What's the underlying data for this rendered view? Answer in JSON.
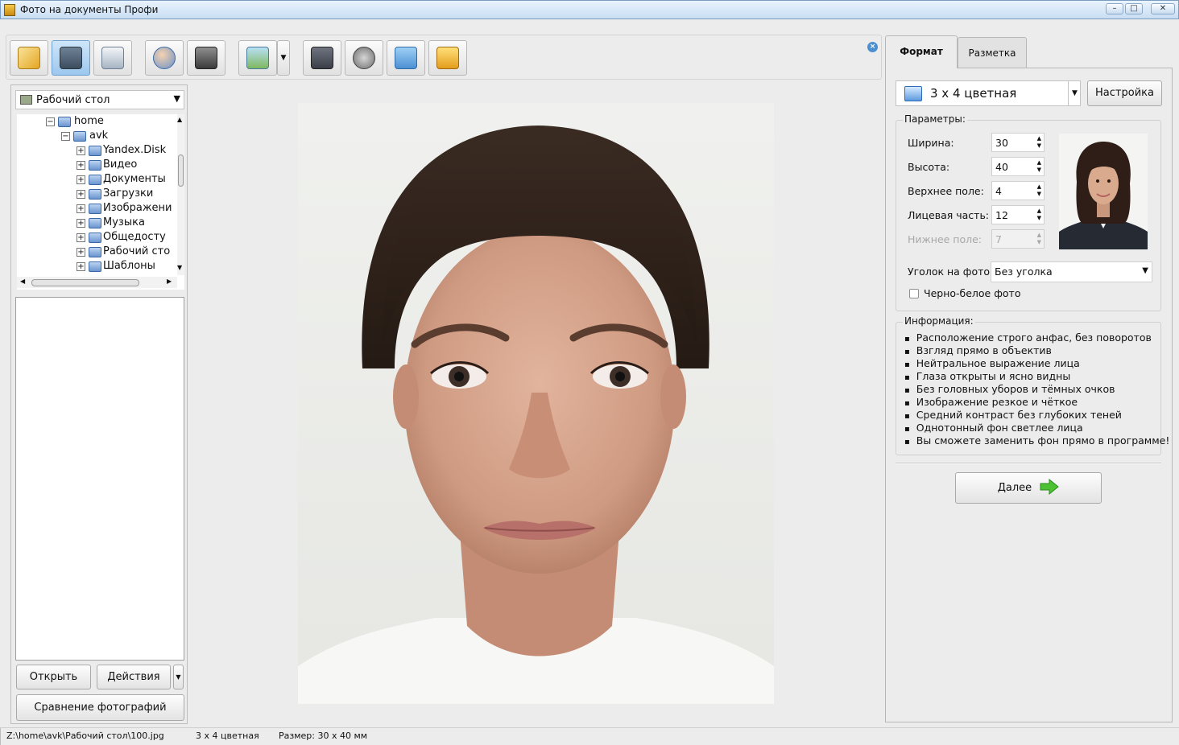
{
  "window": {
    "title": "Фото на документы Профи",
    "min": "–",
    "max": "□",
    "close": "✕"
  },
  "toolbar": {
    "buttons": [
      {
        "icon": "open-folder-icon"
      },
      {
        "icon": "save-icon"
      },
      {
        "icon": "print-icon"
      },
      {
        "icon": "user-photo-icon"
      },
      {
        "icon": "camera-icon"
      },
      {
        "icon": "image-search-icon"
      },
      {
        "icon": "help-book-icon"
      },
      {
        "icon": "video-film-icon"
      },
      {
        "icon": "home-icon"
      },
      {
        "icon": "shopping-cart-icon"
      }
    ],
    "dropdown_arrow": "▼",
    "close": "×"
  },
  "left_panel": {
    "location": "Рабочий стол",
    "tree": [
      {
        "label": "home",
        "expanded": true,
        "level": 0
      },
      {
        "label": "avk",
        "expanded": true,
        "level": 1
      },
      {
        "label": "Yandex.Disk",
        "level": 2
      },
      {
        "label": "Видео",
        "level": 2
      },
      {
        "label": "Документы",
        "level": 2
      },
      {
        "label": "Загрузки",
        "level": 2
      },
      {
        "label": "Изображени",
        "level": 2
      },
      {
        "label": "Музыка",
        "level": 2
      },
      {
        "label": "Общедосту",
        "level": 2
      },
      {
        "label": "Рабочий сто",
        "level": 2
      },
      {
        "label": "Шаблоны",
        "level": 2
      }
    ],
    "open_button": "Открыть",
    "actions_button": "Действия",
    "compare_button": "Сравнение фотографий"
  },
  "right_panel": {
    "tabs": {
      "format": "Формат",
      "markup": "Разметка"
    },
    "format_value": "3 x 4 цветная",
    "settings_button": "Настройка",
    "params_title": "Параметры:",
    "params": [
      {
        "label": "Ширина:",
        "value": "30",
        "disabled": false
      },
      {
        "label": "Высота:",
        "value": "40",
        "disabled": false
      },
      {
        "label": "Верхнее поле:",
        "value": "4",
        "disabled": false
      },
      {
        "label": "Лицевая часть:",
        "value": "12",
        "disabled": false
      },
      {
        "label": "Нижнее поле:",
        "value": "7",
        "disabled": true
      }
    ],
    "corner_label": "Уголок на фото:",
    "corner_value": "Без уголка",
    "bw_label": "Черно-белое фото",
    "bw_checked": false,
    "info_title": "Информация:",
    "info": [
      "Расположение строго анфас, без поворотов",
      "Взгляд прямо в объектив",
      "Нейтральное выражение лица",
      "Глаза открыты и ясно видны",
      "Без головных уборов и тёмных очков",
      "Изображение резкое и чёткое",
      "Средний контраст без глубоких теней",
      "Однотонный фон светлее лица",
      "Вы сможете заменить фон прямо в программе!"
    ],
    "next_button": "Далее"
  },
  "status": {
    "path": "Z:\\home\\avk\\Рабочий стол\\100.jpg",
    "format": "3 x 4 цветная",
    "size": "Размер: 30 x 40 мм"
  }
}
